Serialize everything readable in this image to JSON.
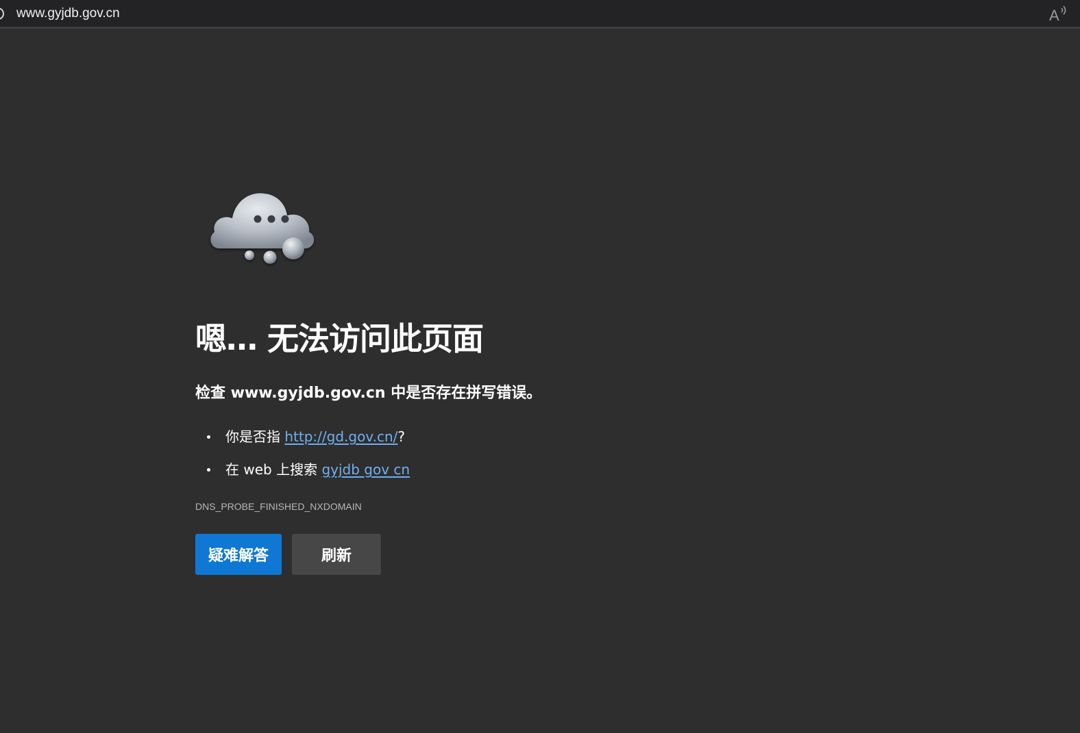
{
  "address_bar": {
    "url": "www.gyjdb.gov.cn",
    "site_info_icon": "site-info-icon",
    "read_aloud_icon": "read-aloud-icon"
  },
  "error_page": {
    "illustration": "cloud-icon",
    "title": "嗯… 无法访问此页面",
    "subtitle": "检查 www.gyjdb.gov.cn 中是否存在拼写错误。",
    "suggestions": [
      {
        "prefix": "你是否指 ",
        "link": "http://gd.gov.cn/",
        "suffix": "?"
      },
      {
        "prefix": "在 web 上搜索 ",
        "link": "gyjdb gov cn",
        "suffix": ""
      }
    ],
    "error_code": "DNS_PROBE_FINISHED_NXDOMAIN",
    "buttons": {
      "troubleshoot": "疑难解答",
      "refresh": "刷新"
    }
  },
  "colors": {
    "page_background": "#2e2e2e",
    "address_bar_background": "#232326",
    "link": "#6fb0f0",
    "primary_button": "#0f78d4",
    "secondary_button": "#474747"
  }
}
